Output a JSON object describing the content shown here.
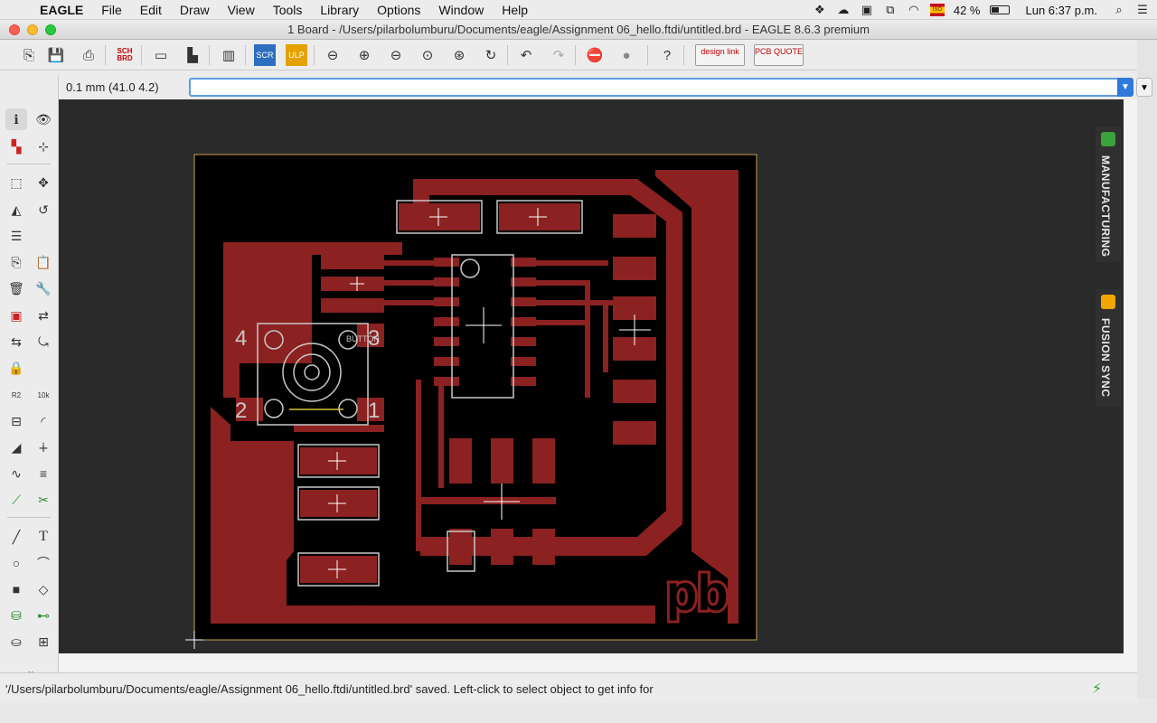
{
  "menubar": {
    "app_name": "EAGLE",
    "items": [
      "File",
      "Edit",
      "Draw",
      "View",
      "Tools",
      "Library",
      "Options",
      "Window",
      "Help"
    ],
    "battery": "42 %",
    "clock": "Lun 6:37 p.m.",
    "flag_label": "ISO"
  },
  "window": {
    "title": "1 Board - /Users/pilarbolumburu/Documents/eagle/Assignment 06_hello.ftdi/untitled.brd - EAGLE 8.6.3 premium"
  },
  "toolbar": {
    "sch_brd_label": "SCH BRD",
    "scr_label": "SCR",
    "ulp_label": "ULP",
    "designlink_label": "design link",
    "pcb_quote_label": "PCB QUOTE"
  },
  "command": {
    "coordinate": "0.1 mm (41.0 4.2)",
    "value": ""
  },
  "board": {
    "button_label": "BUTTON",
    "pin_labels": [
      "4",
      "3",
      "2",
      "1"
    ],
    "logo_text": "pb"
  },
  "sidepanel": {
    "tabs": [
      "MANUFACTURING",
      "FUSION SYNC"
    ]
  },
  "status": {
    "message": "'/Users/pilarbolumburu/Documents/eagle/Assignment 06_hello.ftdi/untitled.brd' saved. Left-click to select object to get info for"
  },
  "colors": {
    "copper": "#8b2120",
    "board_bg": "#000000",
    "canvas_bg": "#2a2a2a",
    "outline": "#c8a24a",
    "silk": "#c8c8c8"
  }
}
